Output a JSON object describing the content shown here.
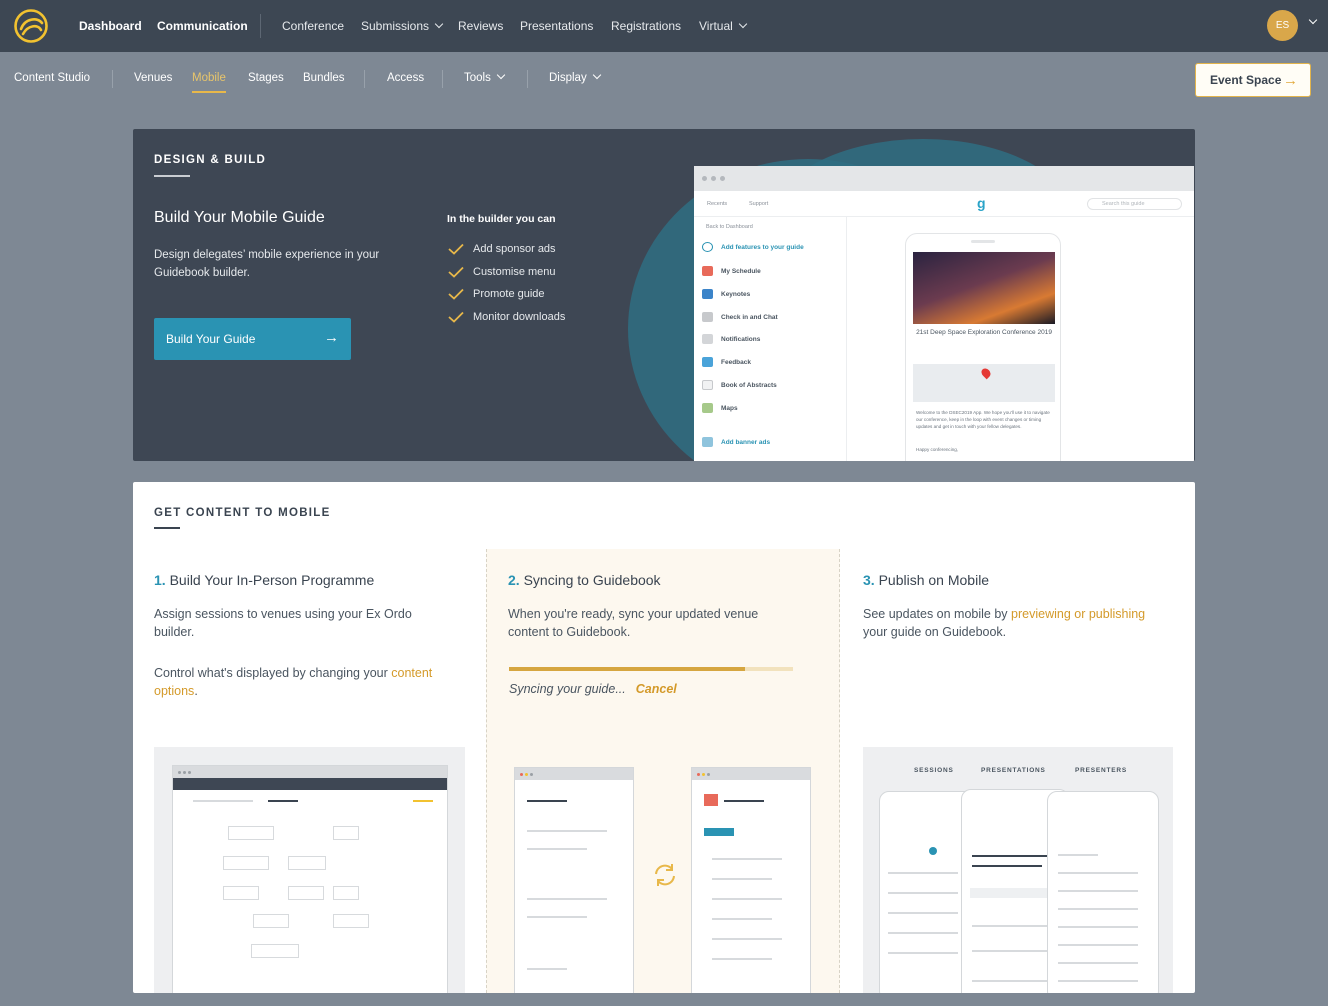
{
  "topnav": {
    "items": [
      {
        "label": "Dashboard"
      },
      {
        "label": "Communication"
      },
      {
        "label": "Conference"
      },
      {
        "label": "Submissions"
      },
      {
        "label": "Reviews"
      },
      {
        "label": "Presentations"
      },
      {
        "label": "Registrations"
      },
      {
        "label": "Virtual"
      }
    ],
    "avatar_initials": "ES"
  },
  "subnav": {
    "items": [
      {
        "label": "Content Studio"
      },
      {
        "label": "Venues"
      },
      {
        "label": "Mobile"
      },
      {
        "label": "Stages"
      },
      {
        "label": "Bundles"
      },
      {
        "label": "Access"
      },
      {
        "label": "Tools"
      },
      {
        "label": "Display"
      }
    ],
    "active": "Mobile",
    "event_space_button": "Event Space"
  },
  "hero": {
    "section_title": "DESIGN & BUILD",
    "heading": "Build Your Mobile Guide",
    "description": "Design delegates’ mobile experience in your Guidebook builder.",
    "button_label": "Build Your Guide",
    "builder_title": "In the builder you can",
    "features": [
      "Add sponsor ads",
      "Customise menu",
      "Promote guide",
      "Monitor downloads"
    ],
    "mockup": {
      "toolbar_recents": "Recents",
      "toolbar_support": "Support",
      "search_placeholder": "Search this guide",
      "back": "Back to Dashboard",
      "add_features": "Add features to your guide",
      "menu": [
        "My Schedule",
        "Keynotes",
        "Check in and Chat",
        "Notifications",
        "Feedback",
        "Book of Abstracts",
        "Maps"
      ],
      "add_banner": "Add banner ads",
      "conference_title": "21st Deep Space Exploration Conference 2019",
      "welcome_text": "Welcome to the DSEC2019 App. We hope you'll use it to navigate our conference, keep in the loop with event changes or timing updates and get in touch with your fellow delegates.",
      "happy": "Happy conferencing,"
    }
  },
  "content": {
    "section_title": "GET CONTENT TO MOBILE",
    "steps": [
      {
        "number": "1.",
        "title": "Build Your In-Person Programme",
        "text1": "Assign sessions to venues using your Ex Ordo builder.",
        "text2_prefix": "Control what's displayed by changing your ",
        "text2_link": "content options",
        "text2_suffix": "."
      },
      {
        "number": "2.",
        "title": "Syncing to Guidebook",
        "text1": "When you're ready, sync your updated venue content to Guidebook.",
        "syncing": "Syncing your guide...",
        "cancel": "Cancel",
        "progress": 0.83
      },
      {
        "number": "3.",
        "title": "Publish on Mobile",
        "text_prefix": "See updates on mobile by ",
        "text_link": "previewing or publishing",
        "text_suffix": " your guide on Guidebook."
      }
    ],
    "thumb3_tabs": [
      "SESSIONS",
      "PRESENTATIONS",
      "PRESENTERS"
    ]
  },
  "colors": {
    "topnav_bg": "#3d4753",
    "accent_gold": "#d49a2a",
    "accent_teal": "#2a93b3",
    "page_bg": "#7e8894"
  }
}
